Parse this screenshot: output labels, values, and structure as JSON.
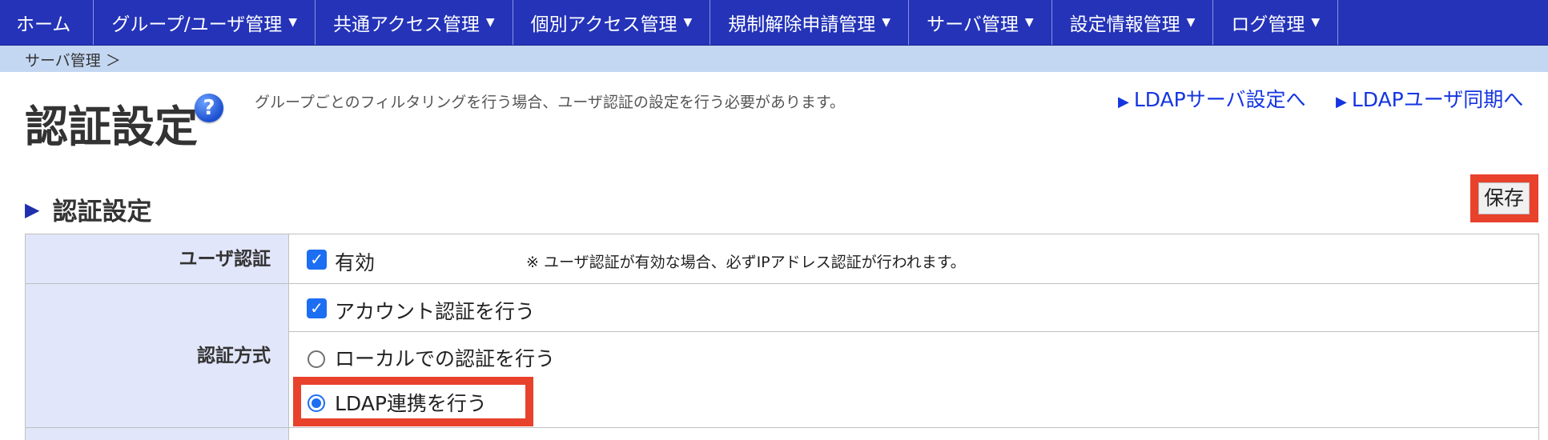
{
  "nav": {
    "items": [
      {
        "label": "ホーム",
        "dropdown": false
      },
      {
        "label": "グループ/ユーザ管理",
        "dropdown": true
      },
      {
        "label": "共通アクセス管理",
        "dropdown": true
      },
      {
        "label": "個別アクセス管理",
        "dropdown": true
      },
      {
        "label": "規制解除申請管理",
        "dropdown": true
      },
      {
        "label": "サーバ管理",
        "dropdown": true
      },
      {
        "label": "設定情報管理",
        "dropdown": true
      },
      {
        "label": "ログ管理",
        "dropdown": true
      }
    ],
    "caret": "▼"
  },
  "breadcrumb": "サーバ管理 ＞",
  "page": {
    "title": "認証設定",
    "help": "?",
    "description": "グループごとのフィルタリングを行う場合、ユーザ認証の設定を行う必要があります。",
    "links": [
      "LDAPサーバ設定へ",
      "LDAPユーザ同期へ"
    ],
    "link_arrow": "▶"
  },
  "section": {
    "arrow": "▶",
    "title": "認証設定",
    "save_label": "保存"
  },
  "form": {
    "user_auth": {
      "label": "ユーザ認証",
      "checkbox_label": "有効",
      "checked": true,
      "note": "※ ユーザ認証が有効な場合、必ずIPアドレス認証が行われます。"
    },
    "auth_method": {
      "label": "認証方式",
      "account_auth": {
        "label": "アカウント認証を行う",
        "checked": true
      },
      "options": [
        {
          "label": "ローカルでの認証を行う",
          "selected": false
        },
        {
          "label": "LDAP連携を行う",
          "selected": true
        }
      ]
    }
  },
  "colors": {
    "nav_bg": "#2433b8",
    "breadcrumb_bg": "#c4d7f2",
    "link": "#1535e0",
    "highlight": "#e8412c",
    "checkbox": "#1c6ef2",
    "header_cell_bg": "#e2e6fa"
  }
}
